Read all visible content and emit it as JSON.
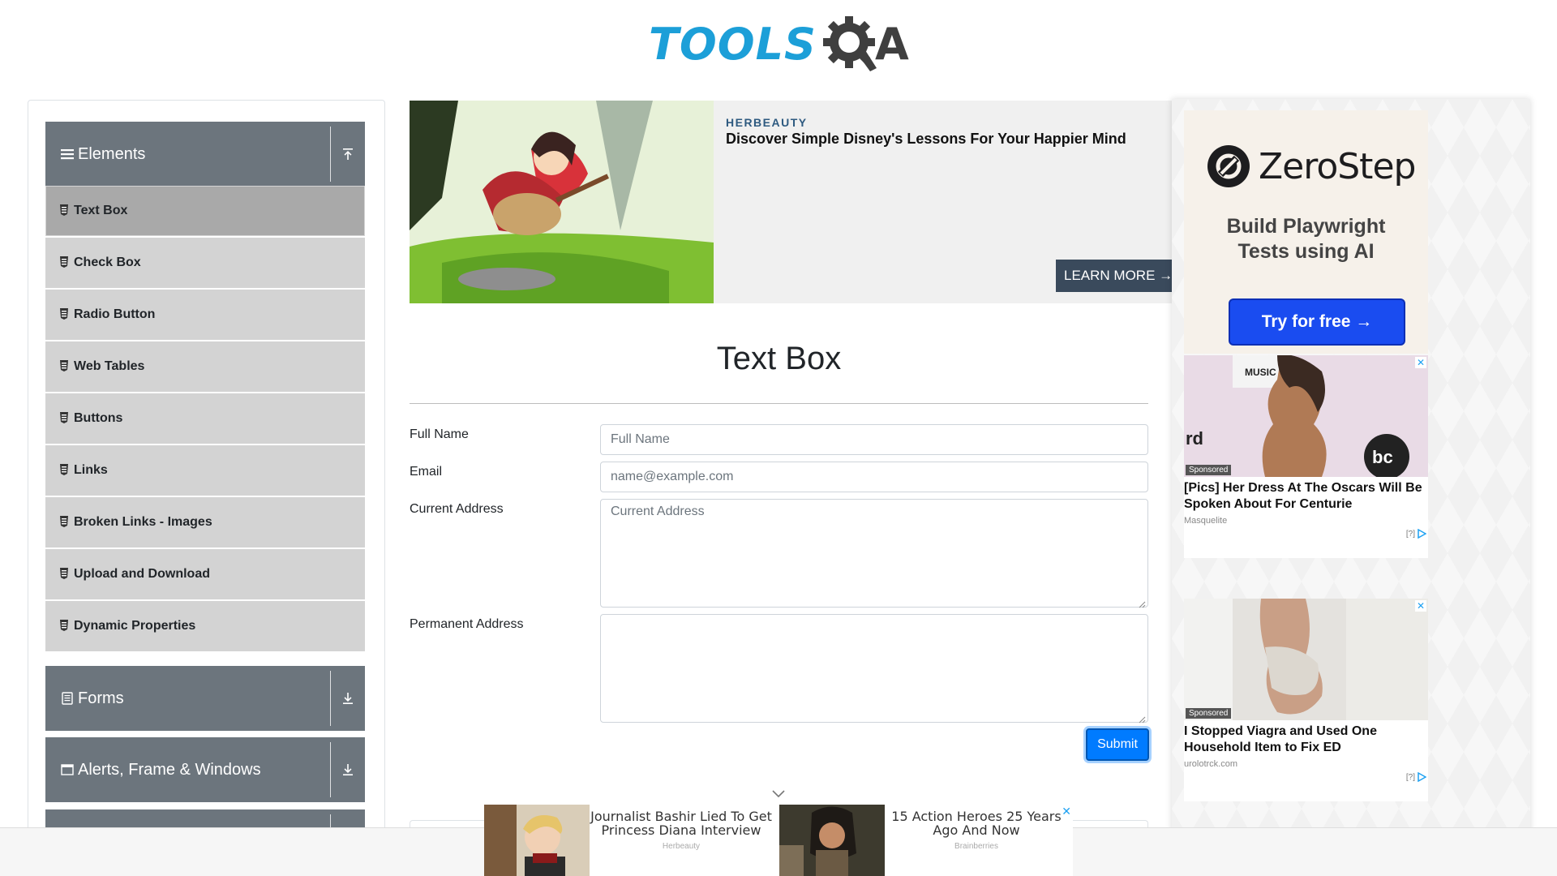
{
  "header": {
    "logo_text": "TOOLSQA",
    "logo_tools": "TOOLS",
    "logo_a": "A"
  },
  "sidebar": {
    "groups": [
      {
        "label": "Elements",
        "icon": "hamburger-icon",
        "toggle_icon": "collapse-up-icon"
      },
      {
        "label": "Forms",
        "icon": "document-icon",
        "toggle_icon": "expand-down-icon"
      },
      {
        "label": "Alerts, Frame & Windows",
        "icon": "window-icon",
        "toggle_icon": "expand-down-icon"
      }
    ],
    "items": [
      {
        "label": "Text Box",
        "active": true
      },
      {
        "label": "Check Box"
      },
      {
        "label": "Radio Button"
      },
      {
        "label": "Web Tables"
      },
      {
        "label": "Buttons"
      },
      {
        "label": "Links"
      },
      {
        "label": "Broken Links - Images"
      },
      {
        "label": "Upload and Download"
      },
      {
        "label": "Dynamic Properties"
      }
    ]
  },
  "banner": {
    "brand": "HERBEAUTY",
    "title": "Discover Simple Disney's Lessons For Your Happier Mind",
    "cta": "LEARN MORE →"
  },
  "main": {
    "title": "Text Box",
    "fields": [
      {
        "label": "Full Name",
        "placeholder": "Full Name",
        "value": ""
      },
      {
        "label": "Email",
        "placeholder": "name@example.com",
        "value": ""
      },
      {
        "label": "Current Address",
        "placeholder": "Current Address",
        "value": ""
      },
      {
        "label": "Permanent Address",
        "placeholder": "",
        "value": ""
      }
    ],
    "submit_label": "Submit"
  },
  "right_ads": {
    "zerostep": {
      "name": "ZeroStep",
      "tagline_1": "Build Playwright",
      "tagline_2": "Tests using AI",
      "cta": "Try for free →"
    },
    "cards": [
      {
        "sponsored": "Sponsored",
        "title": "[Pics] Her Dress At The Oscars Will Be Spoken About For Centurie",
        "source": "Masquelite",
        "choices": "[?]"
      },
      {
        "sponsored": "Sponsored",
        "title": "I Stopped Viagra and Used One Household Item to Fix ED",
        "source": "urolotrck.com",
        "choices": "[?]"
      }
    ]
  },
  "sticky_ad": {
    "items": [
      {
        "title": "Journalist Bashir Lied To Get Princess Diana Interview",
        "source": "Herbeauty"
      },
      {
        "title": "15 Action Heroes 25 Years Ago And Now",
        "source": "Brainberries"
      }
    ]
  },
  "colors": {
    "accent": "#007bff",
    "sidebar_header": "#6c757d",
    "menu_item": "#d3d3d3",
    "menu_active": "#a9a9a9",
    "logo_blue": "#1c9fd8"
  }
}
